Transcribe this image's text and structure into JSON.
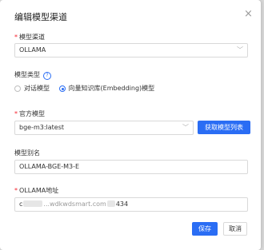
{
  "dialog": {
    "title": "编辑模型渠道",
    "close_icon": "×"
  },
  "fields": {
    "channel": {
      "required_mark": "*",
      "label": "模型渠道",
      "value": "OLLAMA"
    },
    "model_type": {
      "label": "模型类型",
      "help_icon": "?",
      "options": [
        {
          "label": "对话模型",
          "selected": false
        },
        {
          "label": "向量知识库(Embedding)模型",
          "selected": true
        }
      ]
    },
    "official_model": {
      "required_mark": "*",
      "label": "官方模型",
      "value": "bge-m3:latest",
      "fetch_button": "获取模型列表"
    },
    "alias": {
      "label": "模型别名",
      "value": "OLLAMA-BGE-M3-E"
    },
    "address": {
      "required_mark": "*",
      "label": "OLLAMA地址",
      "value_prefix": "c",
      "value_mid": "...wdkwdsmart.com",
      "value_suffix": "434"
    }
  },
  "footer": {
    "save": "保存",
    "cancel": "取消"
  },
  "colors": {
    "accent": "#2a6df4",
    "required": "#f5222d"
  }
}
